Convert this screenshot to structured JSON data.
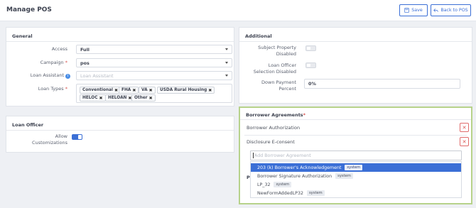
{
  "header": {
    "title": "Manage POS",
    "save_label": "Save",
    "back_label": "Back to POS"
  },
  "general": {
    "title": "General",
    "access_label": "Access",
    "access_value": "Full",
    "campaign_label": "Campaign",
    "campaign_value": "pos",
    "loan_assistant_label": "Loan Assistant",
    "loan_assistant_placeholder": "Loan Assistant",
    "loan_types_label": "Loan Types",
    "loan_types": [
      "Conventional",
      "FHA",
      "VA",
      "USDA Rural Housing",
      "HELOC",
      "HELOAN",
      "Other"
    ],
    "remove_glyph": "✖"
  },
  "loan_officer": {
    "title": "Loan Officer",
    "allow_customizations_label_line1": "Allow",
    "allow_customizations_label_line2": "Customizations",
    "allow_customizations_on": true
  },
  "additional": {
    "title": "Additional",
    "subject_property_line1": "Subject Property",
    "subject_property_line2": "Disabled",
    "subject_property_on": false,
    "loan_officer_selection_line1": "Loan Officer",
    "loan_officer_selection_line2": "Selection Disabled",
    "loan_officer_selection_on": false,
    "down_payment_line1": "Down Payment",
    "down_payment_line2": "Percent",
    "down_payment_value": "0%"
  },
  "borrower_agreements": {
    "title": "Borrower Agreements",
    "required_marker": "*",
    "selected": [
      "Borrower Authorization",
      "Disclosure E-consent"
    ],
    "remove_glyph": "✕",
    "search_placeholder": "Add Borrower Agreement",
    "options": [
      {
        "label": "203 (k) Borrower's Acknowledgement",
        "badge": "system"
      },
      {
        "label": "Borrower Signature Authorization",
        "badge": "system"
      },
      {
        "label": "LP_32",
        "badge": "system"
      },
      {
        "label": "NewFormAddedLP32",
        "badge": "system"
      }
    ],
    "obscured_label": "P"
  },
  "colors": {
    "accent": "#3b6fd6",
    "highlight_border": "#b7d28b",
    "danger": "#d9534f"
  }
}
